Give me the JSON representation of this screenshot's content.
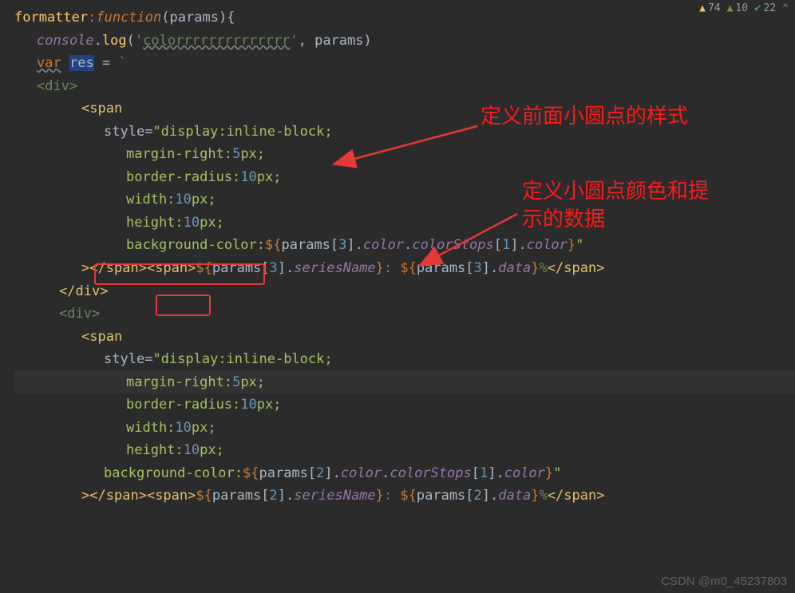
{
  "status": {
    "warn1_count": "74",
    "warn2_count": "10",
    "ok_count": "22"
  },
  "code": {
    "l1_a": "formatter",
    "l1_b": ":",
    "l1_c": "function",
    "l1_d": "(",
    "l1_e": "params",
    "l1_f": "){",
    "l2_a": "console",
    "l2_b": ".",
    "l2_c": "log",
    "l2_d": "(",
    "l2_e": "'",
    "l2_f": "colorrrrrrrrrrrrrr",
    "l2_g": "'",
    "l2_h": ", params)",
    "l3_a": "var",
    "l3_b": " ",
    "l3_c": "res",
    "l3_d": " = ",
    "l3_e": "`",
    "l4": "<div>",
    "l5_a": "<",
    "l5_b": "span",
    "l6_a": "style",
    "l6_b": "=",
    "l6_c": "\"display:inline-block;",
    "l7": "margin-right:",
    "l7_n": "5",
    "l7_b": "px;",
    "l8": "border-radius:",
    "l8_n": "10",
    "l8_b": "px;",
    "l9": "width:",
    "l9_n": "10",
    "l9_b": "px;",
    "l10": "height:",
    "l10_n": "10",
    "l10_b": "px;",
    "l11_a": "background-color",
    "l11_b": ":",
    "l11_c": "${",
    "l11_d": "params",
    "l11_e": "[",
    "l11_f": "3",
    "l11_g": "]",
    "l11_h": ".",
    "l11_i": "color",
    "l11_j": ".",
    "l11_k": "colorStops",
    "l11_l": "[",
    "l11_m": "1",
    "l11_n": "]",
    "l11_o": ".",
    "l11_p": "color",
    "l11_q": "}",
    "l11_r": "\"",
    "l12_a": ">",
    "l12_b": "</",
    "l12_c": "span",
    "l12_d": ">",
    "l12_e": "<",
    "l12_f": "span",
    "l12_g": ">",
    "l12_h": "${",
    "l12_i": "params",
    "l12_j": "[",
    "l12_k": "3",
    "l12_l": "]",
    "l12_m": ".",
    "l12_n": "seriesName",
    "l12_o": "}",
    "l12_p": ": ",
    "l12_q": "${",
    "l12_r": "params",
    "l12_s": "[",
    "l12_t": "3",
    "l12_u": "]",
    "l12_v": ".",
    "l12_w": "data",
    "l12_x": "}",
    "l12_y": "%",
    "l12_z": "</",
    "l12_aa": "span",
    "l12_ab": ">",
    "l13": "</",
    "l13_b": "div",
    "l13_c": ">",
    "l14": "<div>",
    "l15_a": "<",
    "l15_b": "span",
    "l16_a": "style",
    "l16_b": "=",
    "l16_c": "\"display:inline-block;",
    "l17": "margin-right:",
    "l17_n": "5",
    "l17_b": "px;",
    "l18": "border-radius:",
    "l18_n": "10",
    "l18_b": "px;",
    "l19": "width:",
    "l19_n": "10",
    "l19_b": "px;",
    "l20": "height:",
    "l20_n": "10",
    "l20_b": "px;",
    "l21_a": "background-color",
    "l21_b": ":",
    "l21_c": "${",
    "l21_d": "params",
    "l21_e": "[",
    "l21_f": "2",
    "l21_g": "]",
    "l21_h": ".",
    "l21_i": "color",
    "l21_j": ".",
    "l21_k": "colorStops",
    "l21_l": "[",
    "l21_m": "1",
    "l21_n": "]",
    "l21_o": ".",
    "l21_p": "color",
    "l21_q": "}",
    "l21_r": "\"",
    "l22_a": ">",
    "l22_b": "</",
    "l22_c": "span",
    "l22_d": ">",
    "l22_e": "<",
    "l22_f": "span",
    "l22_g": ">",
    "l22_h": "${",
    "l22_i": "params",
    "l22_j": "[",
    "l22_k": "2",
    "l22_l": "]",
    "l22_m": ".",
    "l22_n": "seriesName",
    "l22_o": "}",
    "l22_p": ": ",
    "l22_q": "${",
    "l22_r": "params",
    "l22_s": "[",
    "l22_t": "2",
    "l22_u": "]",
    "l22_v": ".",
    "l22_w": "data",
    "l22_x": "}",
    "l22_y": "%",
    "l22_z": "</",
    "l22_aa": "span",
    "l22_ab": ">"
  },
  "annotations": {
    "a1": "定义前面小圆点的样式",
    "a2_l1": "定义小圆点颜色和提",
    "a2_l2": "示的数据"
  },
  "watermark": "CSDN @m0_45237803"
}
